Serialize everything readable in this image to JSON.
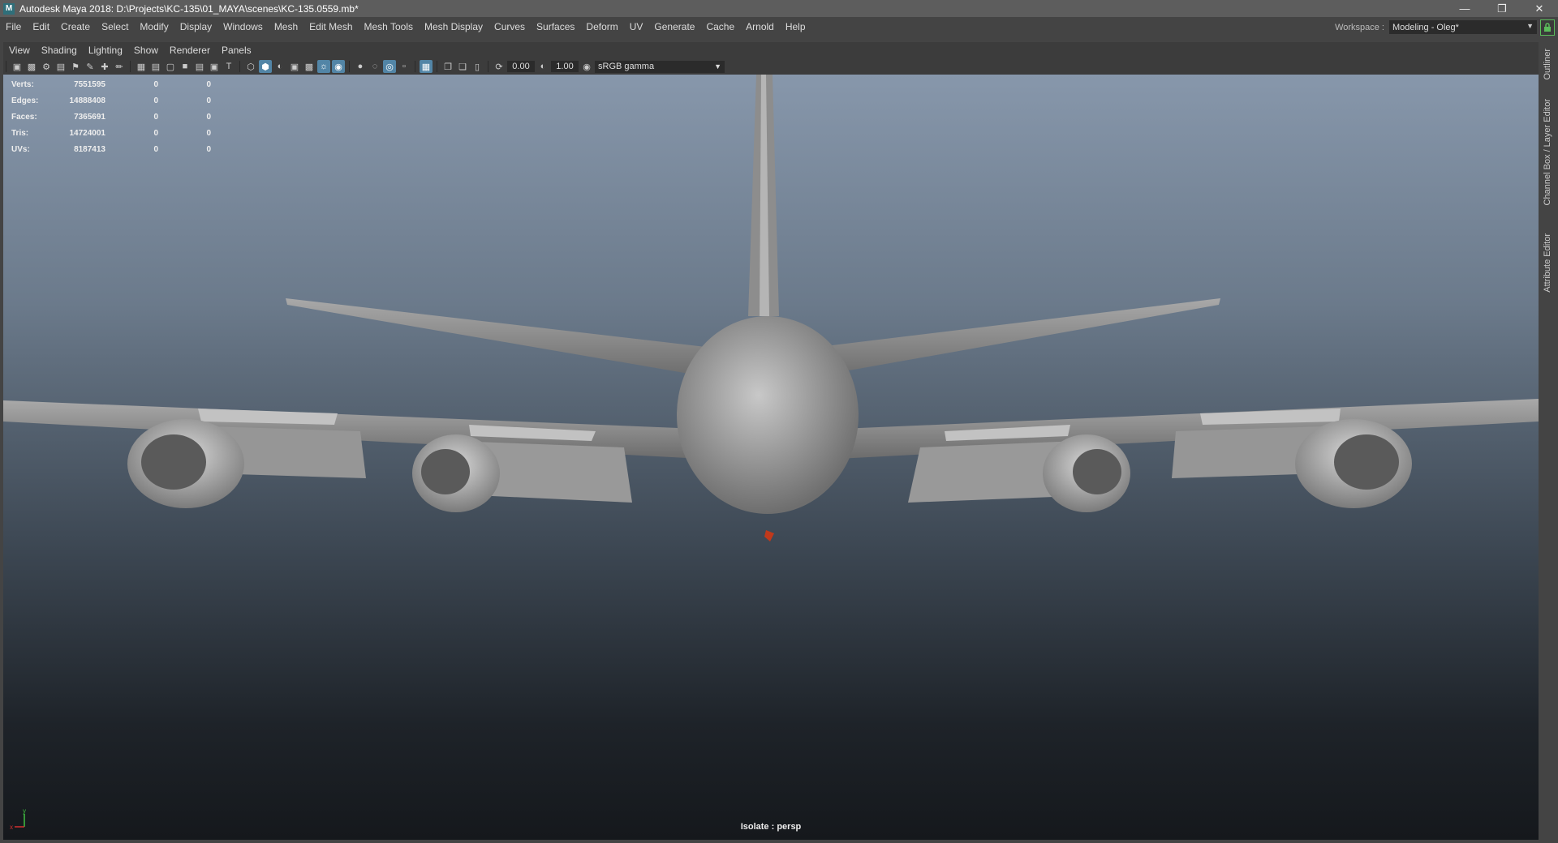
{
  "window": {
    "title": "Autodesk Maya 2018: D:\\Projects\\KC-135\\01_MAYA\\scenes\\KC-135.0559.mb*",
    "app_icon": "M",
    "buttons": [
      "minimize-icon",
      "restore-icon",
      "close-icon"
    ]
  },
  "main_menu": [
    "File",
    "Edit",
    "Create",
    "Select",
    "Modify",
    "Display",
    "Windows",
    "Mesh",
    "Edit Mesh",
    "Mesh Tools",
    "Mesh Display",
    "Curves",
    "Surfaces",
    "Deform",
    "UV",
    "Generate",
    "Cache",
    "Arnold",
    "Help"
  ],
  "workspace": {
    "label": "Workspace :",
    "value": "Modeling - Oleg*"
  },
  "panel_menu": [
    "View",
    "Shading",
    "Lighting",
    "Show",
    "Renderer",
    "Panels"
  ],
  "toolbar": {
    "field_a": "0.00",
    "field_b": "1.00",
    "color_space": "sRGB gamma"
  },
  "hud": [
    {
      "label": "Verts:",
      "value": "7551595",
      "c2": "0",
      "c3": "0"
    },
    {
      "label": "Edges:",
      "value": "14888408",
      "c2": "0",
      "c3": "0"
    },
    {
      "label": "Faces:",
      "value": "7365691",
      "c2": "0",
      "c3": "0"
    },
    {
      "label": "Tris:",
      "value": "14724001",
      "c2": "0",
      "c3": "0"
    },
    {
      "label": "UVs:",
      "value": "8187413",
      "c2": "0",
      "c3": "0"
    }
  ],
  "viewport": {
    "camera_label": "Isolate : persp",
    "axis_labels": {
      "y": "y",
      "x": "x"
    }
  },
  "side_tabs": [
    "Outliner",
    "Channel Box / Layer Editor",
    "Attribute Editor"
  ],
  "colors": {
    "accent": "#5285a6",
    "lock_green": "#5bbb5b",
    "axis_x": "#d03030",
    "axis_y": "#40c040"
  }
}
